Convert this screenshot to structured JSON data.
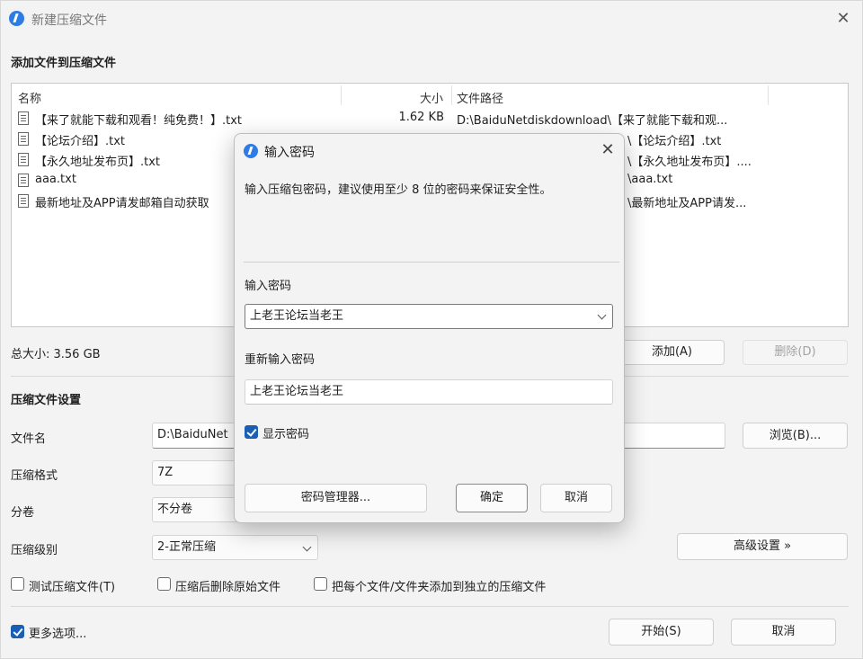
{
  "window": {
    "title": "新建压缩文件",
    "close_symbol": "✕"
  },
  "files_section": {
    "heading": "添加文件到压缩文件",
    "columns": {
      "name": "名称",
      "size": "大小",
      "path": "文件路径"
    },
    "rows": [
      {
        "name": "【来了就能下载和观看！纯免费！】.txt",
        "size": "1.62 KB",
        "path": "D:\\BaiduNetdiskdownload\\【来了就能下载和观..."
      },
      {
        "name": "【论坛介绍】.txt",
        "size": "",
        "path": "\\【论坛介绍】.txt"
      },
      {
        "name": "【永久地址发布页】.txt",
        "size": "",
        "path": "\\【永久地址发布页】...."
      },
      {
        "name": "aaa.txt",
        "size": "",
        "path": "\\aaa.txt"
      },
      {
        "name": "最新地址及APP请发邮箱自动获取",
        "size": "",
        "path": "\\最新地址及APP请发..."
      }
    ],
    "total_label": "总大小: 3.56 GB",
    "add_button": "添加(A)",
    "delete_button": "删除(D)"
  },
  "settings": {
    "heading": "压缩文件设置",
    "filename_label": "文件名",
    "filename_value": "D:\\BaiduNet",
    "browse_button": "浏览(B)...",
    "format_label": "压缩格式",
    "format_value": "7Z",
    "volume_label": "分卷",
    "volume_value": "不分卷",
    "level_label": "压缩级别",
    "level_value": "2-正常压缩",
    "advanced_button": "高级设置 »",
    "checkboxes": {
      "test": {
        "label": "测试压缩文件(T)",
        "checked": false
      },
      "delete_after": {
        "label": "压缩后删除原始文件",
        "checked": false
      },
      "separate": {
        "label": "把每个文件/文件夹添加到独立的压缩文件",
        "checked": false
      }
    }
  },
  "footer": {
    "more_options": {
      "label": "更多选项...",
      "checked": true
    },
    "start_button": "开始(S)",
    "cancel_button": "取消"
  },
  "password_dialog": {
    "title": "输入密码",
    "close_symbol": "✕",
    "message": "输入压缩包密码，建议使用至少 8 位的密码来保证安全性。",
    "password_label": "输入密码",
    "password_value": "上老王论坛当老王",
    "reenter_label": "重新输入密码",
    "reenter_value": "上老王论坛当老王",
    "show_password": {
      "label": "显示密码",
      "checked": true
    },
    "manager_button": "密码管理器...",
    "ok_button": "确定",
    "cancel_button": "取消"
  },
  "colors": {
    "accent": "#1a5fb4",
    "app_icon": "#2d7be5",
    "window_bg": "#f3f3f3"
  }
}
